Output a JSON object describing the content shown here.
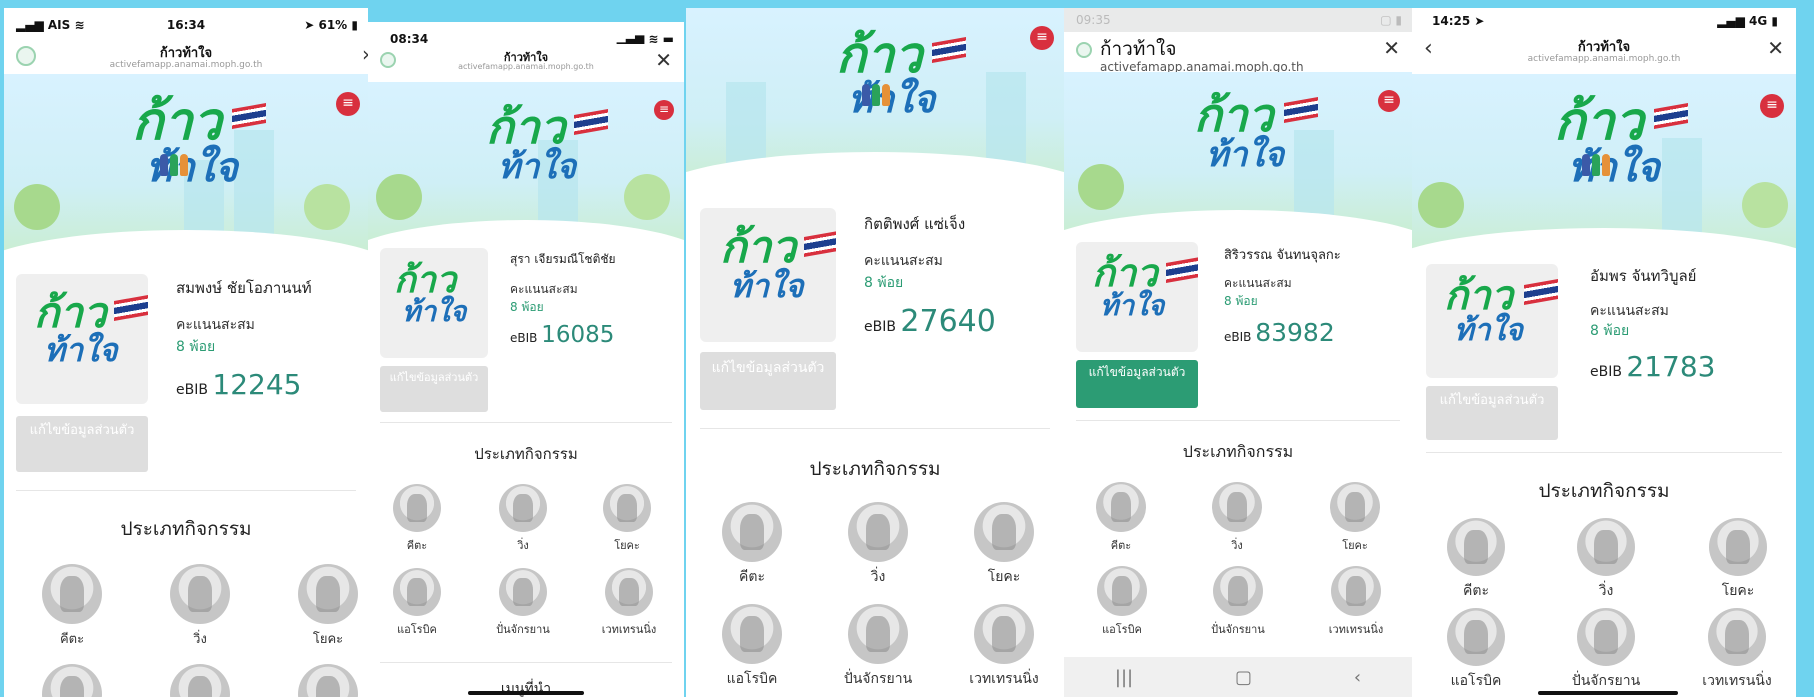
{
  "app": {
    "title": "ก้าวท้าใจ",
    "url": "activefamapp.anamai.moph.go.th",
    "logo_line1": "ก้าว",
    "logo_line2": "ท้าใจ"
  },
  "colors": {
    "accent": "#2c9c74",
    "menu": "#d8303e",
    "background": "#6fd3ef",
    "disabled": "#dedede"
  },
  "common": {
    "points_label": "คะแนนสะสม",
    "points_value": "8 พ้อย",
    "ebib_label": "eBIB",
    "edit_label": "แก้ไขข้อมูลส่วนตัว",
    "activity_section": "ประเภทกิจกรรม",
    "activities": [
      "คีตะ",
      "วิ่ง",
      "โยคะ",
      "แอโรบิค",
      "ปั่นจักรยาน",
      "เวทเทรนนิ่ง"
    ],
    "menu_icon": "hamburger-icon",
    "close_icon": "close-icon",
    "back_icon": "chevron-left-icon"
  },
  "panels": [
    {
      "carrier": "AIS",
      "time": "16:34",
      "battery": "61%",
      "name": "สมพงษ์ ชัยโอภานนท์",
      "ebib": "12245"
    },
    {
      "time": "08:34",
      "name": "สุรา เจียรมณีโชติชัย",
      "ebib": "16085",
      "next_section": "เมนูที่นำ"
    },
    {
      "name": "กิตติพงศ์ แซ่เจ็ง",
      "ebib": "27640"
    },
    {
      "time": "09:35",
      "name": "สิริวรรณ จันทนจุลกะ",
      "ebib": "83982"
    },
    {
      "time": "14:25",
      "network": "4G",
      "name": "อัมพร จันทวิบูลย์",
      "ebib": "21783"
    }
  ]
}
